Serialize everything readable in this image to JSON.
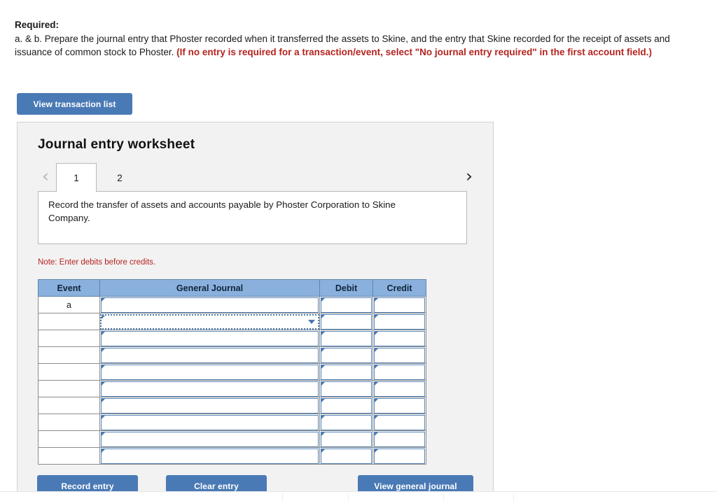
{
  "required": {
    "label": "Required:",
    "body_part1": "a. & b. Prepare the journal entry that Phoster recorded when it transferred the assets to Skine, and the entry that Skine recorded for the receipt of assets and issuance of common stock to Phoster. ",
    "body_emphasis": "(If no entry is required for a transaction/event, select \"No journal entry required\" in the first account field.)"
  },
  "toolbar": {
    "view_transaction_list_label": "View transaction list"
  },
  "worksheet": {
    "title": "Journal entry worksheet",
    "tabs": [
      {
        "label": "1",
        "active": true
      },
      {
        "label": "2",
        "active": false
      }
    ],
    "prev_icon": "‹",
    "next_icon": "›",
    "instruction": "Record the transfer of assets and accounts payable by Phoster Corporation to Skine Company.",
    "note": "Note: Enter debits before credits."
  },
  "journal_table": {
    "columns": [
      "Event",
      "General Journal",
      "Debit",
      "Credit"
    ],
    "rows": [
      {
        "event": "a",
        "general_journal": "",
        "debit": "",
        "credit": "",
        "selected": false
      },
      {
        "event": "",
        "general_journal": "",
        "debit": "",
        "credit": "",
        "selected": true
      },
      {
        "event": "",
        "general_journal": "",
        "debit": "",
        "credit": "",
        "selected": false
      },
      {
        "event": "",
        "general_journal": "",
        "debit": "",
        "credit": "",
        "selected": false
      },
      {
        "event": "",
        "general_journal": "",
        "debit": "",
        "credit": "",
        "selected": false
      },
      {
        "event": "",
        "general_journal": "",
        "debit": "",
        "credit": "",
        "selected": false
      },
      {
        "event": "",
        "general_journal": "",
        "debit": "",
        "credit": "",
        "selected": false
      },
      {
        "event": "",
        "general_journal": "",
        "debit": "",
        "credit": "",
        "selected": false
      },
      {
        "event": "",
        "general_journal": "",
        "debit": "",
        "credit": "",
        "selected": false
      },
      {
        "event": "",
        "general_journal": "",
        "debit": "",
        "credit": "",
        "selected": false
      }
    ]
  },
  "actions": {
    "record_entry_label": "Record entry",
    "clear_entry_label": "Clear entry",
    "view_general_journal_label": "View general journal"
  },
  "colors": {
    "primary_button": "#4a7ab5",
    "table_header": "#8ab0dd",
    "cell_border": "#5886b8",
    "alert_red": "#b5231f",
    "panel_bg": "#f2f2f2"
  }
}
